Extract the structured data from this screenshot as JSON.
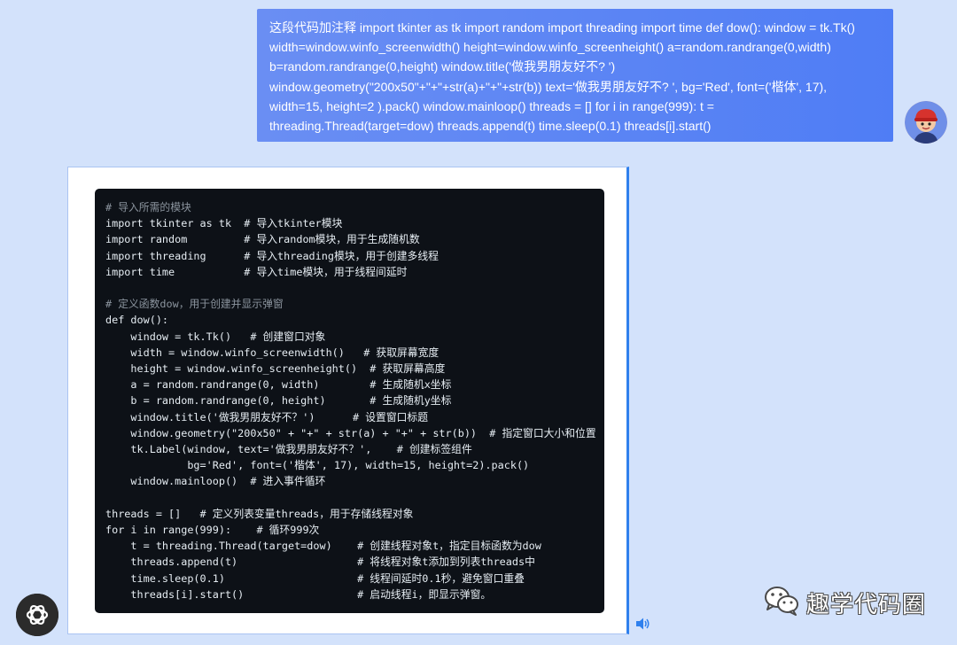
{
  "user_message": {
    "lines": [
      "这段代码加注释 import tkinter as tk import random import threading import time def dow(): window = tk.Tk()",
      "width=window.winfo_screenwidth() height=window.winfo_screenheight() a=random.randrange(0,width)",
      "b=random.randrange(0,height) window.title('做我男朋友好不? ')",
      "window.geometry(\"200x50\"+\"+\"+str(a)+\"+\"+str(b)) text='做我男朋友好不? ', bg='Red', font=('楷体', 17),",
      "width=15, height=2 ).pack() window.mainloop() threads = [] for i in range(999): t =",
      "threading.Thread(target=dow) threads.append(t) time.sleep(0.1) threads[i].start()"
    ]
  },
  "code_block": {
    "lines": [
      "# 导入所需的模块",
      "import tkinter as tk  # 导入tkinter模块",
      "import random         # 导入random模块，用于生成随机数",
      "import threading      # 导入threading模块，用于创建多线程",
      "import time           # 导入time模块，用于线程间延时",
      "",
      "# 定义函数dow，用于创建并显示弹窗",
      "def dow():",
      "    window = tk.Tk()   # 创建窗口对象",
      "    width = window.winfo_screenwidth()   # 获取屏幕宽度",
      "    height = window.winfo_screenheight()  # 获取屏幕高度",
      "    a = random.randrange(0, width)        # 生成随机x坐标",
      "    b = random.randrange(0, height)       # 生成随机y坐标",
      "    window.title('做我男朋友好不？')      # 设置窗口标题",
      "    window.geometry(\"200x50\" + \"+\" + str(a) + \"+\" + str(b))  # 指定窗口大小和位置",
      "    tk.Label(window, text='做我男朋友好不？',    # 创建标签组件",
      "             bg='Red', font=('楷体', 17), width=15, height=2).pack()",
      "    window.mainloop()  # 进入事件循环",
      "",
      "threads = []   # 定义列表变量threads，用于存储线程对象",
      "for i in range(999):    # 循环999次",
      "    t = threading.Thread(target=dow)    # 创建线程对象t，指定目标函数为dow",
      "    threads.append(t)                   # 将线程对象t添加到列表threads中",
      "    time.sleep(0.1)                     # 线程间延时0.1秒，避免窗口重叠",
      "    threads[i].start()                  # 启动线程i，即显示弹窗。"
    ]
  },
  "watermark": {
    "text": "趣学代码圈",
    "icon": "wechat-icon"
  },
  "icons": {
    "assistant": "openai-logo-icon",
    "user": "user-avatar-icon",
    "speaker": "speaker-icon"
  },
  "colors": {
    "page_bg": "#d3e2fb",
    "user_bubble": "#5b86f4",
    "code_bg": "#0d1117",
    "accent_border": "#2f80ed"
  }
}
